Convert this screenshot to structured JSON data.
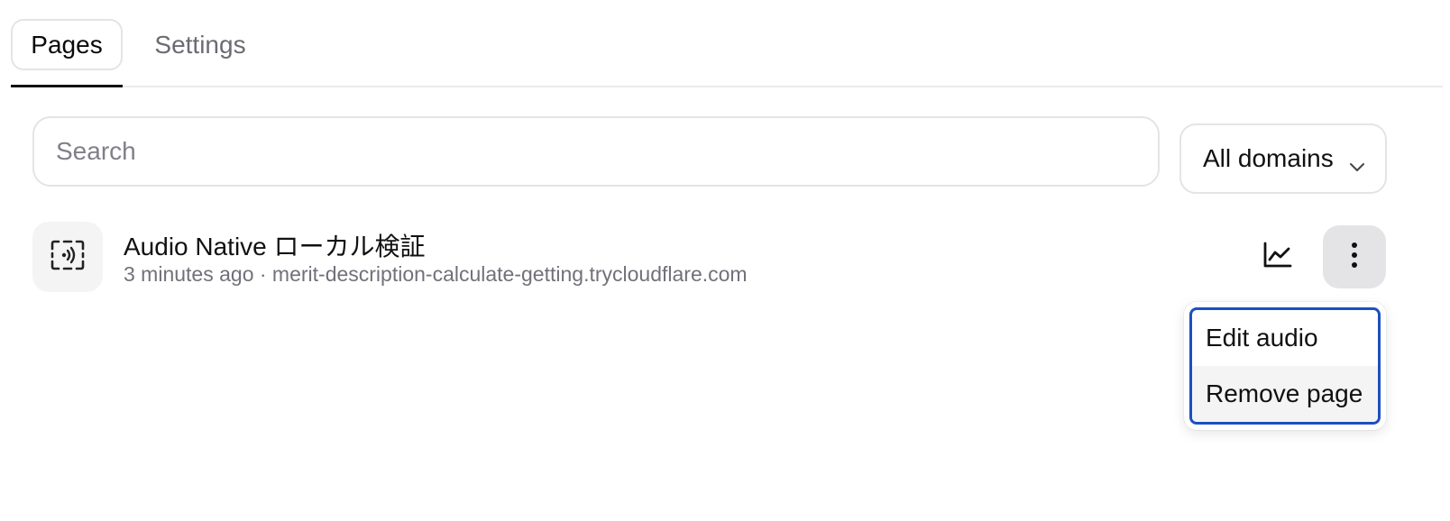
{
  "tabs": {
    "pages": "Pages",
    "settings": "Settings"
  },
  "search": {
    "placeholder": "Search",
    "value": ""
  },
  "domain_filter": {
    "selected": "All domains",
    "icon": "chevron-down-icon"
  },
  "pages": [
    {
      "title": "Audio Native ローカル検証",
      "meta": "3 minutes ago · merit-description-calculate-getting.trycloudflare.com",
      "icon": "audio-waves-icon"
    }
  ],
  "row_actions": {
    "analytics_icon": "chart-line-icon",
    "more_icon": "more-vertical-icon"
  },
  "menu": {
    "items": [
      {
        "label": "Edit audio"
      },
      {
        "label": "Remove page"
      }
    ]
  },
  "colors": {
    "focus_ring": "#1d4fbf",
    "muted_text": "#71717a",
    "border": "#e4e4e7"
  }
}
